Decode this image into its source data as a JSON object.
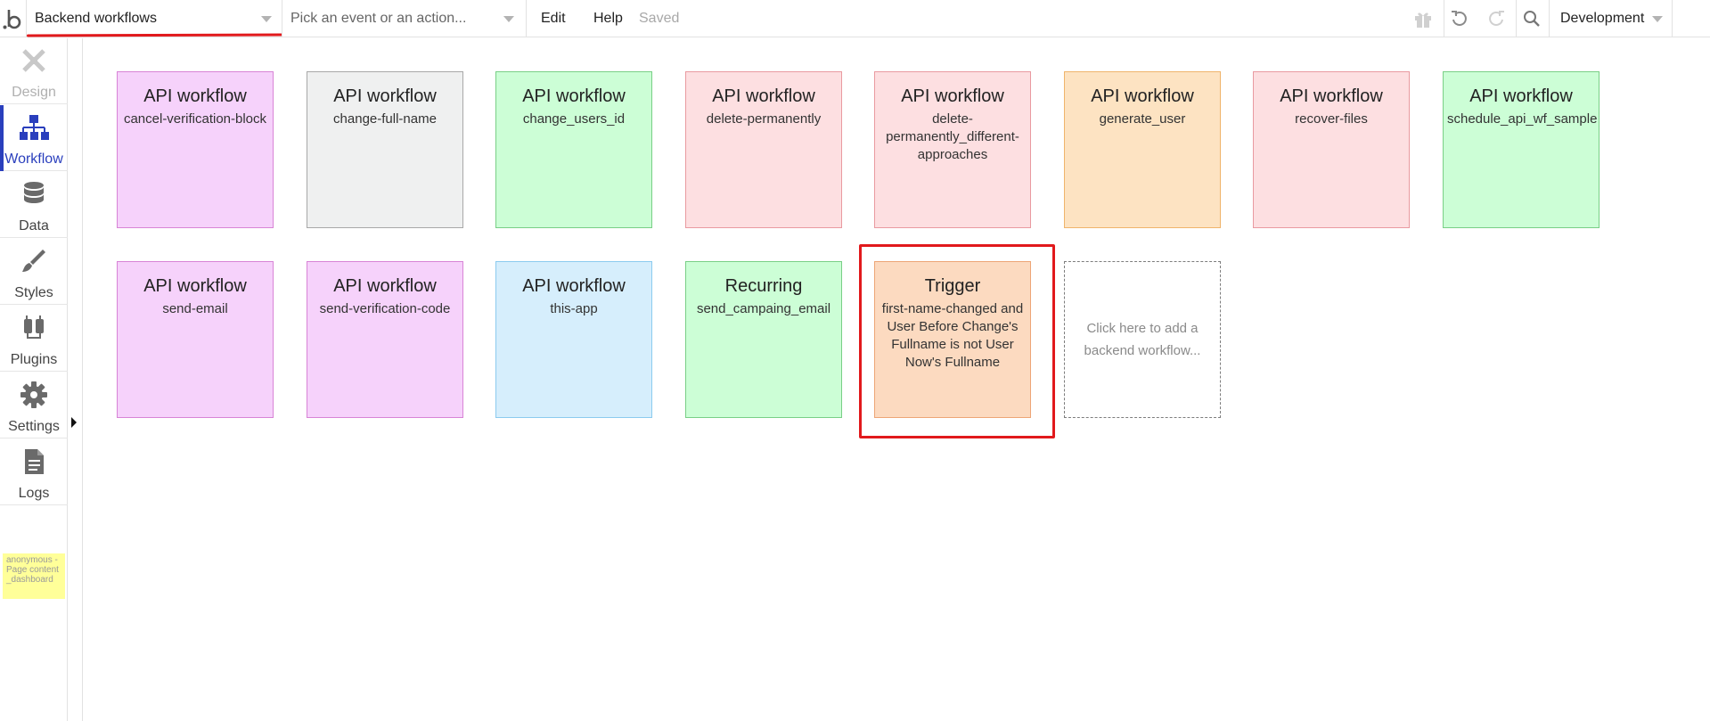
{
  "topbar": {
    "logo": "b",
    "page_select": "Backend workflows",
    "event_placeholder": "Pick an event or an action...",
    "edit": "Edit",
    "help": "Help",
    "saved": "Saved",
    "environment": "Development"
  },
  "sidebar": {
    "items": [
      {
        "label": "Design",
        "icon": "design-icon",
        "state": "disabled"
      },
      {
        "label": "Workflow",
        "icon": "workflow-icon",
        "state": "active"
      },
      {
        "label": "Data",
        "icon": "database-icon",
        "state": "normal"
      },
      {
        "label": "Styles",
        "icon": "brush-icon",
        "state": "normal"
      },
      {
        "label": "Plugins",
        "icon": "plug-icon",
        "state": "normal"
      },
      {
        "label": "Settings",
        "icon": "gear-icon",
        "state": "normal"
      },
      {
        "label": "Logs",
        "icon": "document-icon",
        "state": "normal"
      }
    ],
    "user_note": "anonymous - Page content_dashboard"
  },
  "workflows": [
    {
      "type": "API workflow",
      "name": "cancel-verification-block",
      "color": "pink"
    },
    {
      "type": "API workflow",
      "name": "change-full-name",
      "color": "gray"
    },
    {
      "type": "API workflow",
      "name": "change_users_id",
      "color": "green"
    },
    {
      "type": "API workflow",
      "name": "delete-permanently",
      "color": "red"
    },
    {
      "type": "API workflow",
      "name": "delete-permanently_different-approaches",
      "color": "red"
    },
    {
      "type": "API workflow",
      "name": "generate_user",
      "color": "orange"
    },
    {
      "type": "API workflow",
      "name": "recover-files",
      "color": "red"
    },
    {
      "type": "API workflow",
      "name": "schedule_api_wf_sample",
      "color": "green"
    },
    {
      "type": "API workflow",
      "name": "send-email",
      "color": "pink"
    },
    {
      "type": "API workflow",
      "name": "send-verification-code",
      "color": "pink"
    },
    {
      "type": "API workflow",
      "name": "this-app",
      "color": "blue"
    },
    {
      "type": "Recurring",
      "name": "send_campaing_email",
      "color": "green"
    },
    {
      "type": "Trigger",
      "name": "first-name-changed and User Before Change's Fullname is not User Now's Fullname",
      "color": "peach"
    }
  ],
  "add_card": "Click here to add a backend workflow...",
  "colors": {
    "accent": "#2a3fbd",
    "highlight": "#e1191c",
    "pink": "#f6d2fb",
    "gray": "#eff0f0",
    "green": "#ccfed6",
    "red": "#fddfe1",
    "orange": "#fde3c2",
    "blue": "#d6eefc",
    "peach": "#fcdac0"
  }
}
